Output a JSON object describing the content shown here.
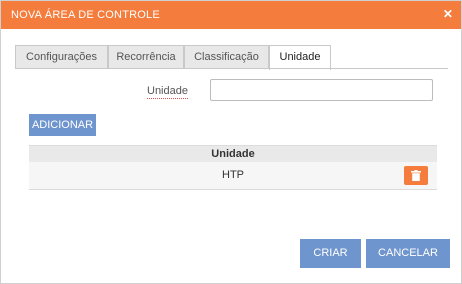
{
  "dialog": {
    "title": "NOVA ÁREA DE CONTROLE",
    "close_icon": "close-icon"
  },
  "tabs": [
    {
      "label": "Configurações",
      "active": false
    },
    {
      "label": "Recorrência",
      "active": false
    },
    {
      "label": "Classificação",
      "active": false
    },
    {
      "label": "Unidade",
      "active": true
    }
  ],
  "form": {
    "unidade_label": "Unidade",
    "unidade_value": "",
    "add_button": "ADICIONAR"
  },
  "table": {
    "header": "Unidade",
    "rows": [
      {
        "value": "HTP",
        "action_icon": "trash-icon"
      }
    ]
  },
  "footer": {
    "create_button": "CRIAR",
    "cancel_button": "CANCELAR"
  },
  "colors": {
    "accent": "#f47c3c",
    "button": "#6f95cf"
  }
}
